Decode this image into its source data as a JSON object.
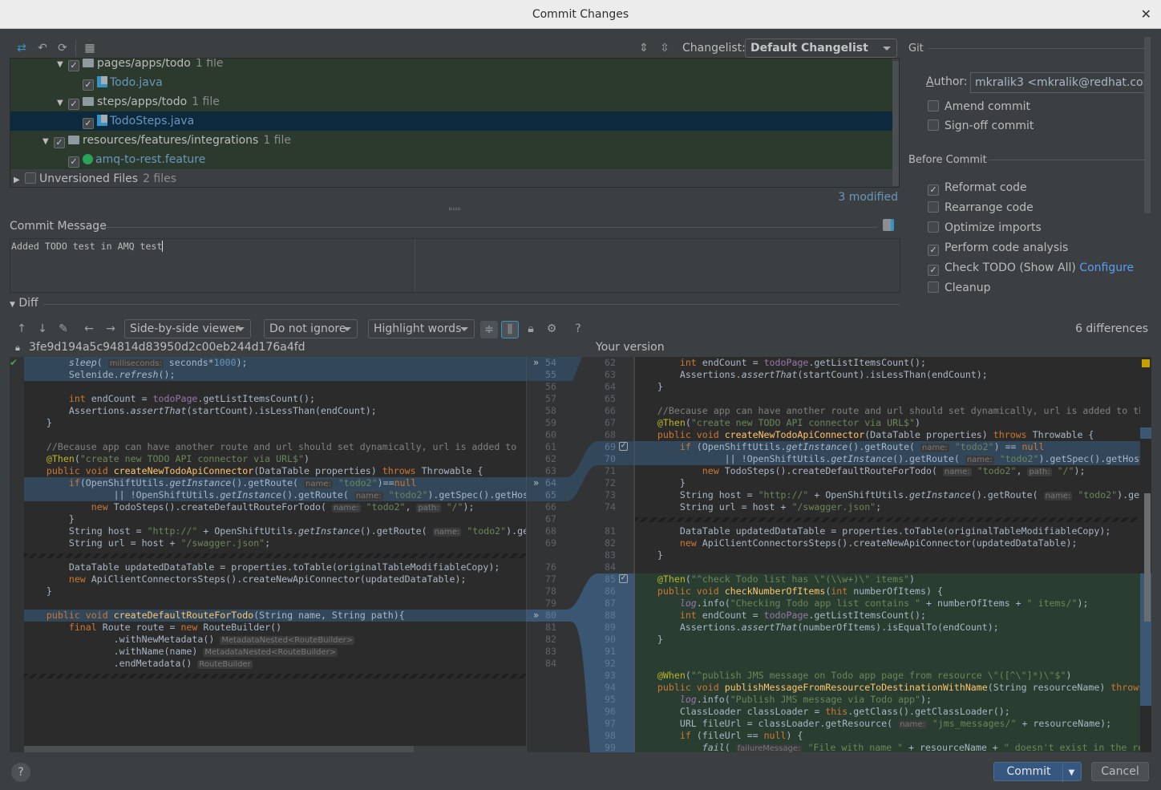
{
  "window": {
    "title": "Commit Changes",
    "close_icon": "close-icon"
  },
  "toolbar": {
    "icons": [
      "show-diff-icon",
      "rollback-icon",
      "refresh-icon",
      "group-by-icon",
      "expand-all-icon",
      "collapse-all-icon"
    ],
    "changelist_label": "Changelist:",
    "changelist_value": "Default Changelist"
  },
  "tree": {
    "rows": [
      {
        "depth": 3,
        "expanded": true,
        "checked": true,
        "kind": "folder",
        "label": "pages/apps/todo",
        "count": "1 file",
        "style": "changed"
      },
      {
        "depth": 4,
        "checked": true,
        "kind": "java",
        "label": "Todo.java",
        "style": "changed"
      },
      {
        "depth": 3,
        "expanded": true,
        "checked": true,
        "kind": "folder",
        "label": "steps/apps/todo",
        "count": "1 file",
        "style": "changed"
      },
      {
        "depth": 4,
        "checked": true,
        "kind": "java",
        "label": "TodoSteps.java",
        "style": "selected"
      },
      {
        "depth": 2,
        "expanded": true,
        "checked": true,
        "kind": "folder",
        "label": "resources/features/integrations",
        "count": "1 file",
        "style": "changed"
      },
      {
        "depth": 3,
        "checked": true,
        "kind": "feature",
        "label": "amq-to-rest.feature",
        "style": "changed"
      },
      {
        "depth": 0,
        "expanded": false,
        "checked": false,
        "kind": "none",
        "label": "Unversioned Files",
        "count": "2 files",
        "style": "plain"
      }
    ],
    "status": "3 modified"
  },
  "commit_message": {
    "label": "Commit Message",
    "value": "Added TODO test in AMQ test"
  },
  "git": {
    "section": "Git",
    "author_label": "Author:",
    "author_value": "mkralik3 <mkralik@redhat.com>",
    "options": [
      {
        "label": "Amend commit",
        "checked": false
      },
      {
        "label": "Sign-off commit",
        "checked": false
      }
    ]
  },
  "before_commit": {
    "section": "Before Commit",
    "options": [
      {
        "label": "Reformat code",
        "checked": true
      },
      {
        "label": "Rearrange code",
        "checked": false
      },
      {
        "label": "Optimize imports",
        "checked": false
      },
      {
        "label": "Perform code analysis",
        "checked": true
      },
      {
        "label": "Check TODO (Show All)",
        "checked": true,
        "link": "Configure"
      },
      {
        "label": "Cleanup",
        "checked": false
      }
    ]
  },
  "diff": {
    "label": "Diff",
    "viewer": "Side-by-side viewer",
    "ignore": "Do not ignore",
    "highlight": "Highlight words",
    "help": "?",
    "differences": "6 differences",
    "left_title": "3fe9d194a5c94814d83950d2c00eb244d176a4fd",
    "right_title": "Your version",
    "accent": "#3592c4",
    "left": [
      {
        "n": 54,
        "type": "changed",
        "code": "        «i|sleep»( «h|milliseconds:» seconds*«n|1000»);"
      },
      {
        "n": 55,
        "type": "changed",
        "code": "        Selenide.«i|refresh»();"
      },
      {
        "n": 56,
        "code": ""
      },
      {
        "n": 57,
        "code": "        «k|int» endCount = «p|todoPage».getListItemsCount();"
      },
      {
        "n": 58,
        "code": "        Assertions.«i|assertThat»(startCount).isLessThan(endCount);"
      },
      {
        "n": 59,
        "code": "    }"
      },
      {
        "n": 60,
        "code": ""
      },
      {
        "n": 61,
        "code": "    «c|//Because app can have another route and url should set dynamically, url is added to»"
      },
      {
        "n": 62,
        "code": "    «a|@Then»(«s|\"create new TODO API connector via URL$\"»)"
      },
      {
        "n": 63,
        "code": "    «k|public void» «f|createNewTodoApiConnector»(DataTable properties) «k|throws» Throwable {"
      },
      {
        "n": 64,
        "type": "changed",
        "code": "        «k|if»(OpenShiftUtils.«i|getInstance»().getRoute( «h|name:» «s|\"todo2\"»)==«k|null»"
      },
      {
        "n": 65,
        "type": "changed",
        "code": "                || !OpenShiftUtils.«i|getInstance»().getRoute( «h|name:» «s|\"todo2\"»).getSpec().getHos"
      },
      {
        "n": 66,
        "code": "            «k|new» TodoSteps().createDefaultRouteForTodo( «h|name:» «s|\"todo2\"», «h|path:» «s|\"/\"»);"
      },
      {
        "n": 67,
        "code": "        }"
      },
      {
        "n": 68,
        "code": "        String host = «s|\"http://\"» + OpenShiftUtils.«i|getInstance»().getRoute( «h|name:» «s|\"todo2\"»).ge"
      },
      {
        "n": 69,
        "code": "        String url = host + «s|\"/swagger.json\"»;"
      },
      {
        "fold": true
      },
      {
        "n": 76,
        "code": "        DataTable updatedDataTable = properties.toTable(originalTableModifiableCopy);"
      },
      {
        "n": 77,
        "code": "        «k|new» ApiClientConnectorsSteps().createNewApiConnector(updatedDataTable);"
      },
      {
        "n": 78,
        "code": "    }"
      },
      {
        "n": 79,
        "code": ""
      },
      {
        "n": 80,
        "type": "changed",
        "code": "    «k|public void» «f|createDefaultRouteForTodo»(String name, String path){"
      },
      {
        "n": 81,
        "code": "        «k|final» Route route = «k|new» RouteBuilder()"
      },
      {
        "n": 82,
        "code": "                .withNewMetadata() «h|MetadataNested<RouteBuilder>»"
      },
      {
        "n": 83,
        "code": "                .withName(name) «h|MetadataNested<RouteBuilder>»"
      },
      {
        "n": 84,
        "code": "                .endMetadata() «h|RouteBuilder»"
      },
      {
        "fold": true
      }
    ],
    "right": [
      {
        "n": 62,
        "code": "        «k|int» endCount = «p|todoPage».getListItemsCount();"
      },
      {
        "n": 63,
        "code": "        Assertions.«i|assertThat»(startCount).isLessThan(endCount);"
      },
      {
        "n": 64,
        "code": "    }"
      },
      {
        "n": 65,
        "code": ""
      },
      {
        "n": 66,
        "code": "    «c|//Because app can have another route and url should set dynamically, url is added to the»"
      },
      {
        "n": 67,
        "code": "    «a|@Then»(«s|\"create new TODO API connector via URL$\"»)"
      },
      {
        "n": 68,
        "code": "    «k|public void» «f|createNewTodoApiConnector»(DataTable properties) «k|throws» Throwable {"
      },
      {
        "n": 69,
        "type": "changed",
        "code": "        «k|if» (OpenShiftUtils.«i|getInstance»().getRoute( «h|name:» «s|\"todo2\"») == «k|null»"
      },
      {
        "n": 70,
        "type": "changed",
        "code": "                || !OpenShiftUtils.«i|getInstance»().getRoute( «h|name:» «s|\"todo2\"»).getSpec().getHost("
      },
      {
        "n": 71,
        "code": "            «k|new» TodoSteps().createDefaultRouteForTodo( «h|name:» «s|\"todo2\"», «h|path:» «s|\"/\"»);"
      },
      {
        "n": 72,
        "code": "        }"
      },
      {
        "n": 73,
        "code": "        String host = «s|\"http://\"» + OpenShiftUtils.«i|getInstance»().getRoute( «h|name:» «s|\"todo2\"»).getS"
      },
      {
        "n": 74,
        "code": "        String url = host + «s|\"/swagger.json\"»;"
      },
      {
        "fold": true
      },
      {
        "n": 81,
        "code": "        DataTable updatedDataTable = properties.toTable(originalTableModifiableCopy);"
      },
      {
        "n": 82,
        "code": "        «k|new» ApiClientConnectorsSteps().createNewApiConnector(updatedDataTable);"
      },
      {
        "n": 83,
        "code": "    }"
      },
      {
        "n": 84,
        "code": ""
      },
      {
        "n": 85,
        "type": "inserted",
        "code": "    «a|@Then»(«s|\"^check Todo list has \\\"(\\\\w+)\\\" items\"»)"
      },
      {
        "n": 86,
        "type": "inserted",
        "code": "    «k|public void» «f|checkNumberOfItems»(«k|int» numberOfItems) {"
      },
      {
        "n": 87,
        "type": "inserted",
        "code": "        «pi|log».info(«s|\"Checking Todo app list contains \"» + numberOfItems + «s|\" items/\"»);"
      },
      {
        "n": 88,
        "type": "inserted",
        "code": "        «k|int» endCount = «p|todoPage».getListItemsCount();"
      },
      {
        "n": 89,
        "type": "inserted",
        "code": "        Assertions.«i|assertThat»(numberOfItems).isEqualTo(endCount);"
      },
      {
        "n": 90,
        "type": "inserted",
        "code": "    }"
      },
      {
        "n": 91,
        "type": "inserted",
        "code": ""
      },
      {
        "n": 92,
        "type": "inserted",
        "code": ""
      },
      {
        "n": 93,
        "type": "inserted",
        "code": "    «a|@When»(«s|\"^publish JMS message on Todo app page from resource \\\"([^\\\"]*)\\\"$\"»)"
      },
      {
        "n": 94,
        "type": "inserted",
        "code": "    «k|public void» «f|publishMessageFromResourceToDestinationWithName»(String resourceName) «k|throws»"
      },
      {
        "n": 95,
        "type": "inserted",
        "code": "        «pi|log».info(«s|\"Publish JMS message via Todo app\"»);"
      },
      {
        "n": 96,
        "type": "inserted",
        "code": "        ClassLoader classLoader = «k|this».getClass().getClassLoader();"
      },
      {
        "n": 97,
        "type": "inserted",
        "code": "        URL fileUrl = classLoader.getResource( «h|name:» «s|\"jms_messages/\"» + resourceName);"
      },
      {
        "n": 98,
        "type": "inserted",
        "code": "        «k|if» (fileUrl == «k|null») {"
      },
      {
        "n": 99,
        "type": "inserted",
        "code": "            «i|fail»( «h|failureMessage:» «s|\"File with name \"» + resourceName + «s|\" doesn't exist in the reso»"
      }
    ]
  },
  "footer": {
    "commit": "Commit",
    "cancel": "Cancel",
    "help": "?"
  }
}
